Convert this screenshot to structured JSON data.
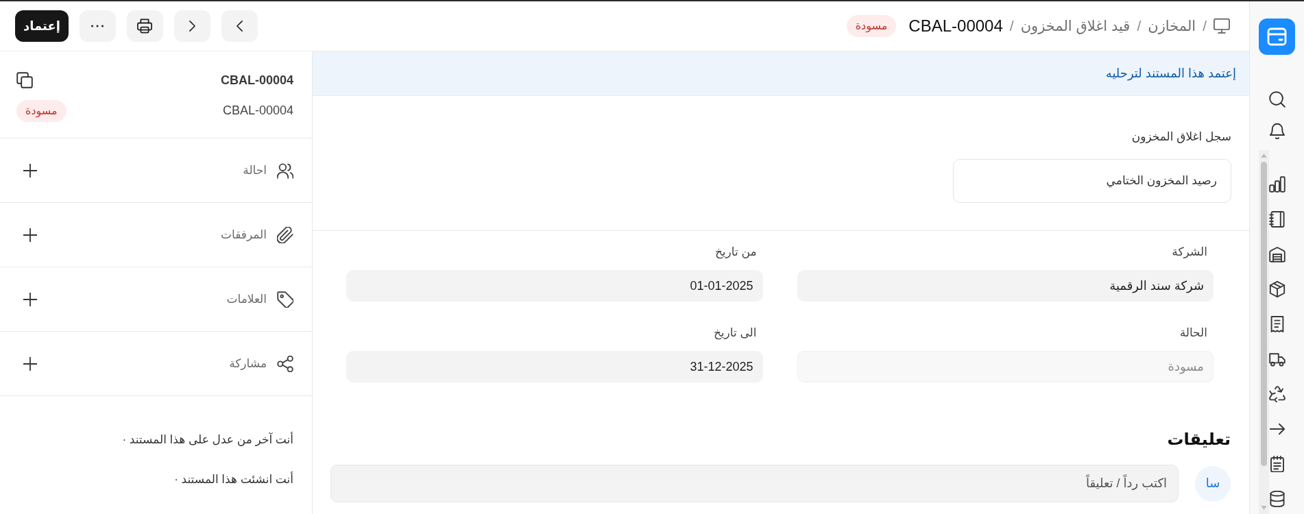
{
  "header": {
    "breadcrumbs": [
      {
        "separator": "/",
        "label": "المخازن",
        "current": false
      },
      {
        "separator": "/",
        "label": "قيد اغلاق المخزون",
        "current": false
      },
      {
        "separator": "/",
        "label": "CBAL-00004",
        "current": true
      }
    ],
    "status_badge": "مسودة",
    "primary_button": "إعتماد"
  },
  "banner": "إعتمد هذا المستند لترحليه",
  "record": {
    "label": "سجل اغلاق المخزون",
    "value": "رصيد المخزون الختامي"
  },
  "fields": [
    {
      "label": "الشركة",
      "value": "شركة سند الرقمية",
      "disabled": false
    },
    {
      "label": "من تاريخ",
      "value": "01-01-2025",
      "disabled": false
    },
    {
      "label": "الحالة",
      "value": "مسودة",
      "disabled": true
    },
    {
      "label": "الى تاريخ",
      "value": "31-12-2025",
      "disabled": false
    }
  ],
  "comments": {
    "title": "تعليقات",
    "avatar": "سا",
    "placeholder": "اكتب رداً / تعليقاً"
  },
  "side_panel": {
    "title": "CBAL-00004",
    "subtitle": "CBAL-00004",
    "status_badge": "مسودة",
    "sections": [
      {
        "label": "احالة"
      },
      {
        "label": "المرفقات"
      },
      {
        "label": "العلامات"
      },
      {
        "label": "مشاركة"
      }
    ],
    "activity": [
      "أنت آخر من عدل على هذا المستند ·",
      "أنت انشئت هذا المستند ·"
    ]
  }
}
